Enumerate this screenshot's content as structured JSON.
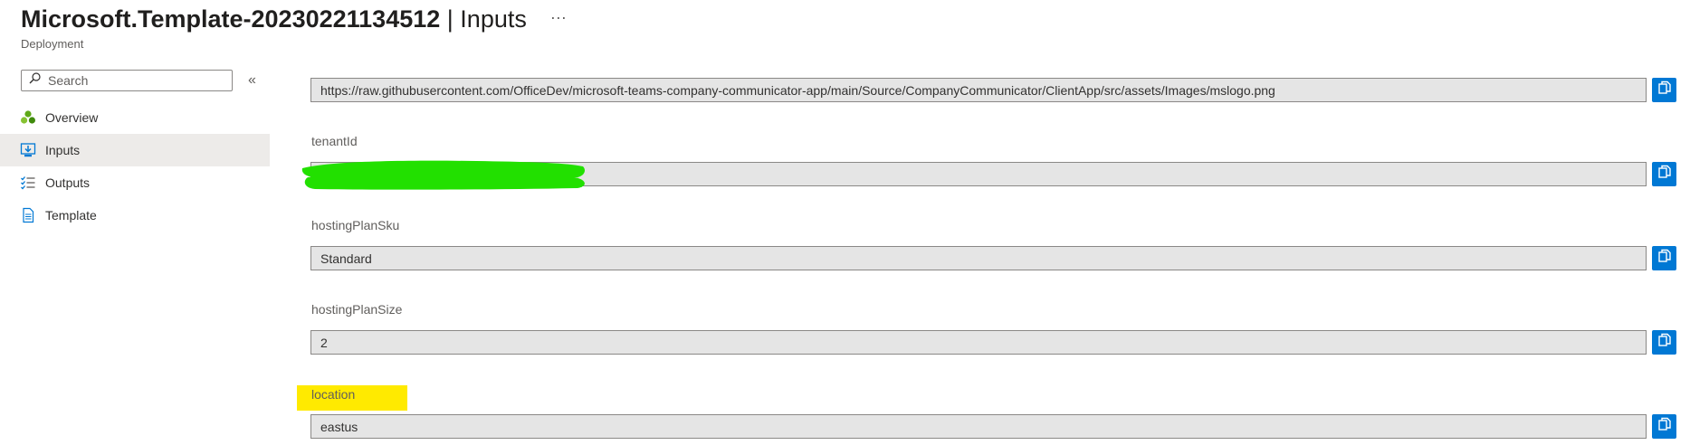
{
  "header": {
    "title": "Microsoft.Template-20230221134512",
    "separator": " | ",
    "section": "Inputs",
    "more": "···",
    "subtitle": "Deployment"
  },
  "search": {
    "placeholder": "Search"
  },
  "collapse_glyph": "«",
  "nav": {
    "items": [
      {
        "label": "Overview",
        "icon": "overview-icon",
        "active": false
      },
      {
        "label": "Inputs",
        "icon": "inputs-icon",
        "active": true
      },
      {
        "label": "Outputs",
        "icon": "outputs-icon",
        "active": false
      },
      {
        "label": "Template",
        "icon": "template-icon",
        "active": false
      }
    ]
  },
  "fields": [
    {
      "label": "",
      "value": "https://raw.githubusercontent.com/OfficeDev/microsoft-teams-company-communicator-app/main/Source/CompanyCommunicator/ClientApp/src/assets/Images/mslogo.png"
    },
    {
      "label": "tenantId",
      "value": "",
      "redacted": true
    },
    {
      "label": "hostingPlanSku",
      "value": "Standard"
    },
    {
      "label": "hostingPlanSize",
      "value": "2"
    },
    {
      "label": "location",
      "value": "eastus",
      "highlighted": true
    }
  ],
  "colors": {
    "accent": "#0078d4",
    "redaction": "#22e000",
    "highlight": "#ffea00",
    "active_nav": "#edebe9"
  }
}
